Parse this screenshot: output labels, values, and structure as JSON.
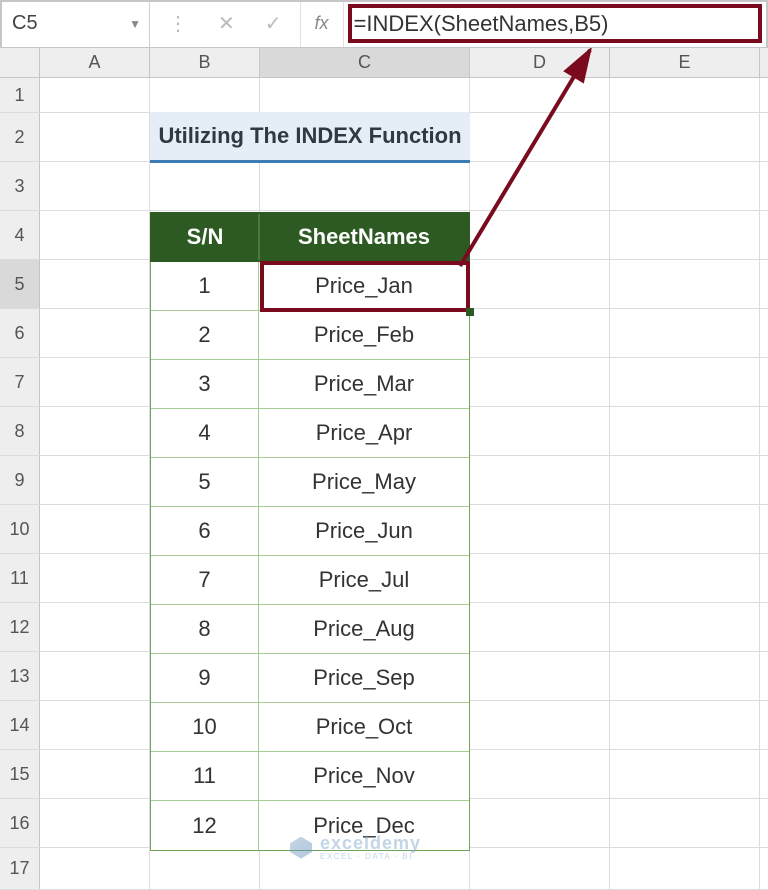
{
  "formula_bar": {
    "cell_ref": "C5",
    "fx_label": "fx",
    "formula": "=INDEX(SheetNames,B5)"
  },
  "columns": [
    "A",
    "B",
    "C",
    "D",
    "E"
  ],
  "row_numbers": [
    "1",
    "2",
    "3",
    "4",
    "5",
    "6",
    "7",
    "8",
    "9",
    "10",
    "11",
    "12",
    "13",
    "14",
    "15",
    "16",
    "17"
  ],
  "title": "Utilizing The INDEX Function",
  "headers": {
    "b": "S/N",
    "c": "SheetNames"
  },
  "rows": [
    {
      "n": "1",
      "name": "Price_Jan"
    },
    {
      "n": "2",
      "name": "Price_Feb"
    },
    {
      "n": "3",
      "name": "Price_Mar"
    },
    {
      "n": "4",
      "name": "Price_Apr"
    },
    {
      "n": "5",
      "name": "Price_May"
    },
    {
      "n": "6",
      "name": "Price_Jun"
    },
    {
      "n": "7",
      "name": "Price_Jul"
    },
    {
      "n": "8",
      "name": "Price_Aug"
    },
    {
      "n": "9",
      "name": "Price_Sep"
    },
    {
      "n": "10",
      "name": "Price_Oct"
    },
    {
      "n": "11",
      "name": "Price_Nov"
    },
    {
      "n": "12",
      "name": "Price_Dec"
    }
  ],
  "watermark": {
    "main": "exceldemy",
    "sub": "EXCEL · DATA · BI"
  },
  "selected_cell": "C5"
}
